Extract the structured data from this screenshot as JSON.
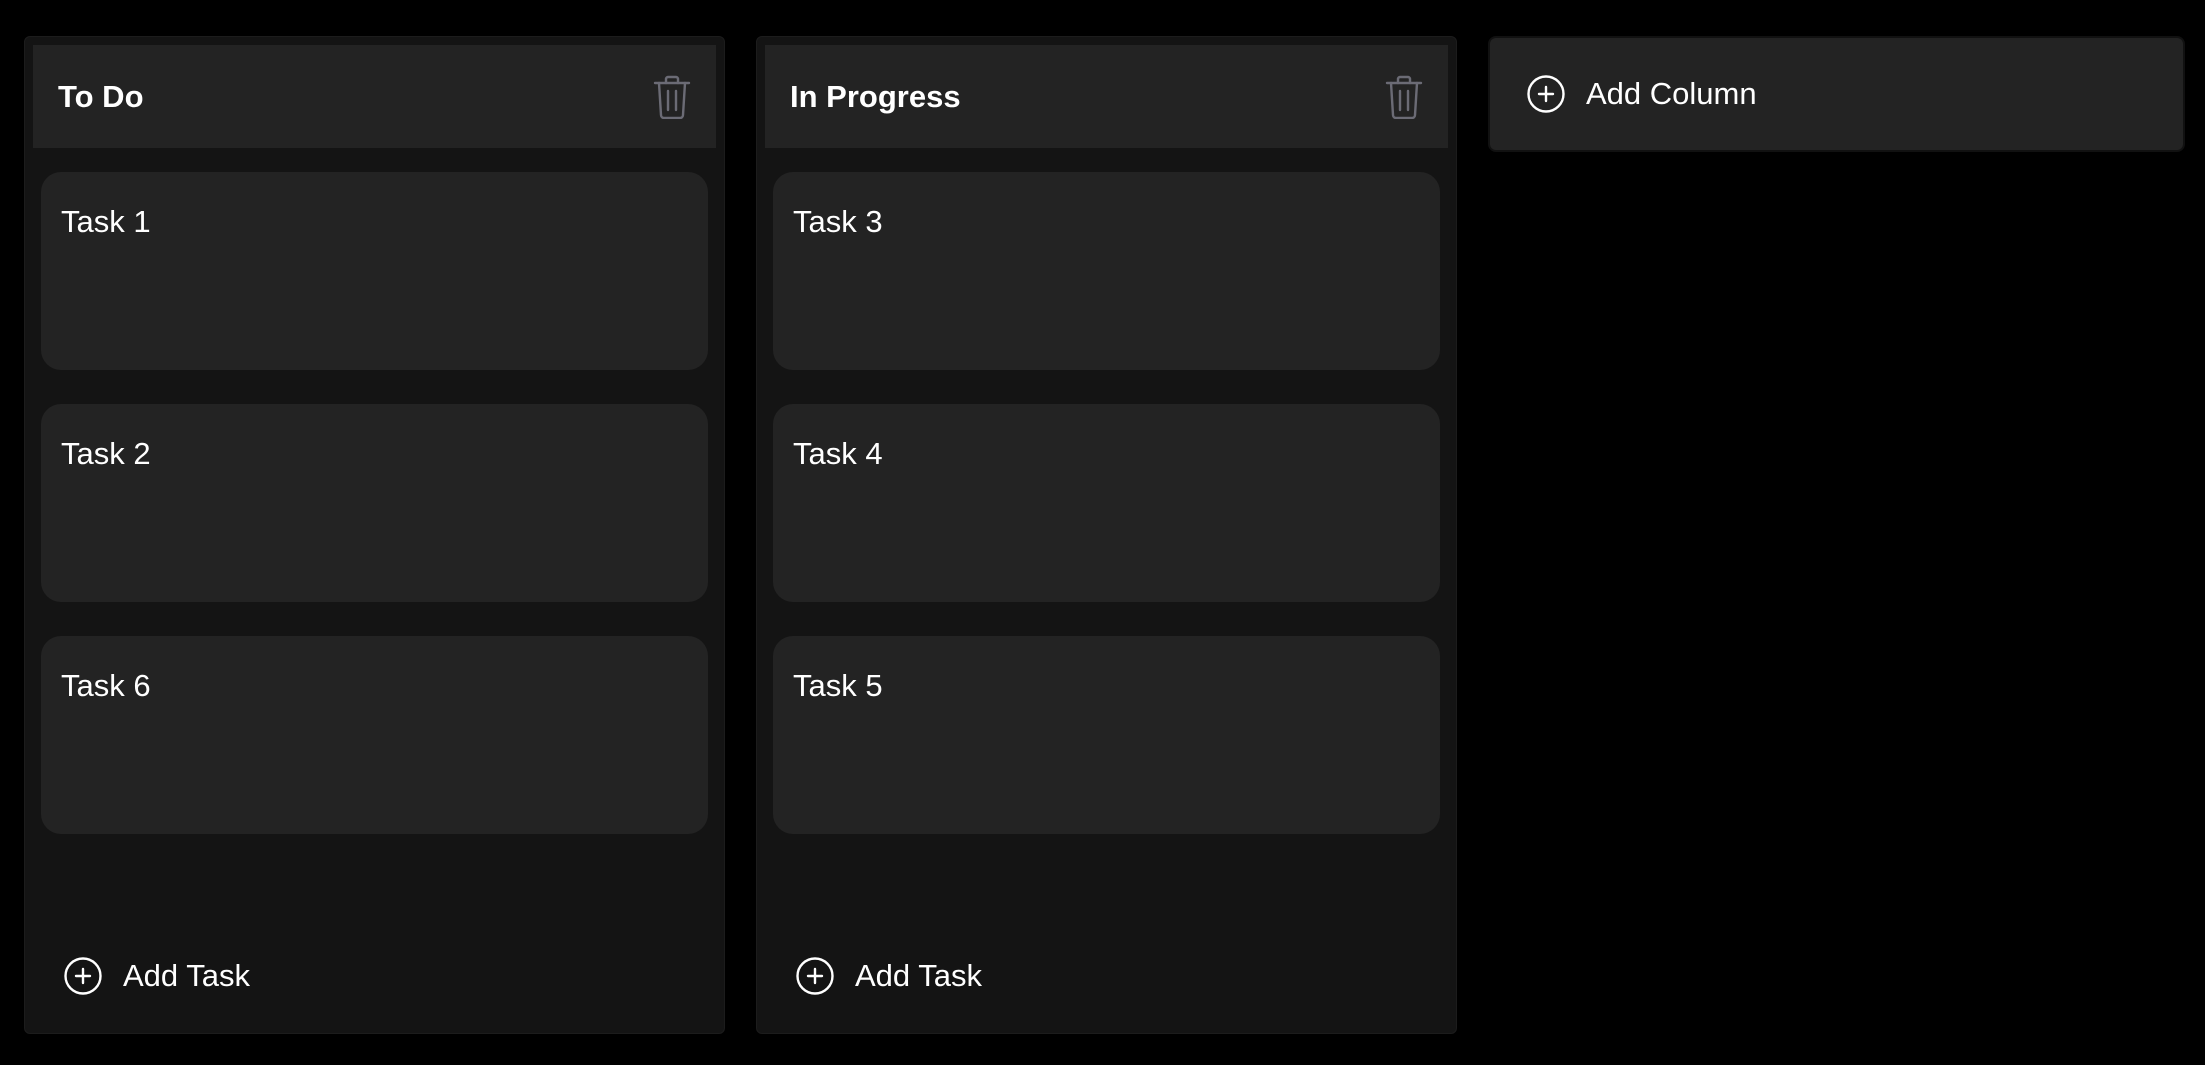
{
  "board": {
    "columns": [
      {
        "title": "To Do",
        "delete_icon": "trash-icon",
        "cards": [
          {
            "text": "Task 1"
          },
          {
            "text": "Task 2"
          },
          {
            "text": "Task 6"
          }
        ],
        "add_task_label": "Add Task"
      },
      {
        "title": "In Progress",
        "delete_icon": "trash-icon",
        "cards": [
          {
            "text": "Task 3"
          },
          {
            "text": "Task 4"
          },
          {
            "text": "Task 5"
          }
        ],
        "add_task_label": "Add Task"
      }
    ],
    "add_column_label": "Add Column"
  },
  "icons": {
    "add": "plus-circle-icon",
    "delete": "trash-icon"
  },
  "colors": {
    "background": "#000000",
    "column": "#141414",
    "header": "#232323",
    "card": "#232323",
    "trash": "#6b6b75",
    "text": "#ffffff"
  }
}
